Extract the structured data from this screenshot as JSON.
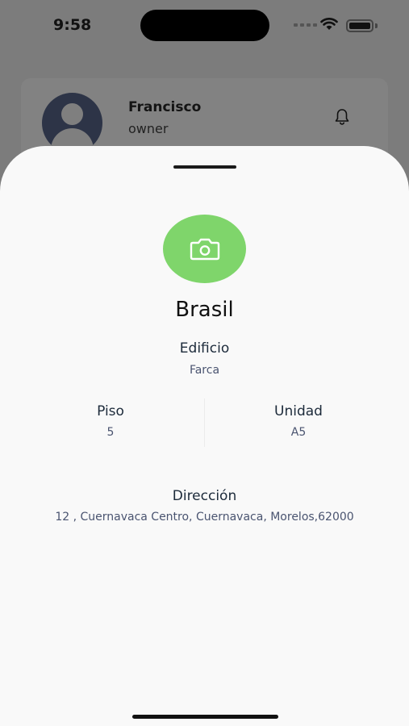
{
  "status_bar": {
    "time": "9:58"
  },
  "profile": {
    "name": "Francisco",
    "role": "owner"
  },
  "sheet": {
    "title": "Brasil",
    "edificio_label": "Edificio",
    "edificio_value": "Farca",
    "piso_label": "Piso",
    "piso_value": "5",
    "unidad_label": "Unidad",
    "unidad_value": "A5",
    "direccion_label": "Dirección",
    "direccion_value": "12 , Cuernavaca Centro, Cuernavaca, Morelos,62000"
  },
  "icons": {
    "camera": "camera-icon",
    "bell": "bell-icon",
    "avatar": "person-icon"
  },
  "colors": {
    "accent_green": "#7fd56b",
    "sheet_bg": "#f9f9f9",
    "overlay": "#7c7c7c"
  }
}
